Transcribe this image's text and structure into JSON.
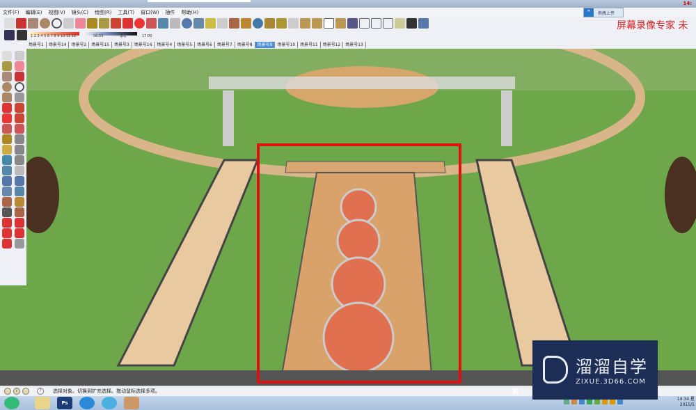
{
  "window": {
    "title_suffix": "14:"
  },
  "menu": [
    "文件(F)",
    "编辑(E)",
    "视图(V)",
    "镜头(C)",
    "绘图(R)",
    "工具(T)",
    "窗口(W)",
    "插件",
    "帮助(H)"
  ],
  "upload_button": "拖拽上传",
  "brand_text": "屏幕录像专家 未",
  "shadow_bar": {
    "months": "1 2 3 4 5 6 7 8 9 10 11 12",
    "time_start": "06:55",
    "time_mid": "中午",
    "time_end": "17:00"
  },
  "scene_tabs": [
    "场景号1",
    "场景号14",
    "场景号2",
    "场景号15",
    "场景号3",
    "场景号16",
    "场景号4",
    "场景号5",
    "场景号6",
    "场景号7",
    "场景号8",
    "场景号9",
    "场景号10",
    "场景号11",
    "场景号12",
    "场景号13"
  ],
  "active_tab": "场景号9",
  "status_text": "选择对象。切换到扩充选择。拖动鼠标选择多项。",
  "watermark": {
    "name": "溜溜自学",
    "url": "ZIXUE.3D66.COM"
  },
  "taskbar": {
    "ps_label": "Ps",
    "k_label": "K",
    "clock_time": "14:34 星",
    "clock_date": "2015/5"
  },
  "colors": {
    "grass": "#6ea64a",
    "highlight": "#e01010",
    "tab_active": "#4a8fd8"
  }
}
